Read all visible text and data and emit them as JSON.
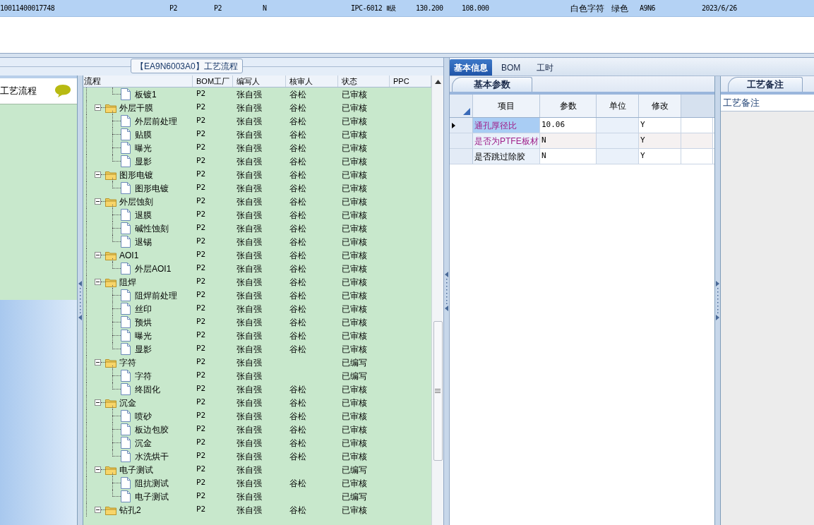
{
  "top_row": {
    "cells": [
      "10011400017748",
      "P2",
      "P2",
      "N",
      "IPC-6012 Ⅱ级",
      "130.200",
      "108.000",
      "白色字符",
      "绿色",
      "A9N6",
      "2023/6/26"
    ]
  },
  "group_title": "【EA9N6003A0】工艺流程",
  "left_panel": {
    "title": "工艺流程"
  },
  "tree": {
    "columns": [
      "流程",
      "BOM工厂",
      "编写人",
      "核审人",
      "状态",
      "PPC"
    ],
    "continued": [
      {
        "name": "板镀1",
        "bom": "P2",
        "writer": "张自强",
        "reviewer": "谷松",
        "status": "已审核"
      }
    ],
    "rows": [
      {
        "name": "外层干膜",
        "bom": "P2",
        "writer": "张自强",
        "reviewer": "谷松",
        "status": "已审核",
        "expanded": true,
        "children": [
          {
            "name": "外层前处理",
            "bom": "P2",
            "writer": "张自强",
            "reviewer": "谷松",
            "status": "已审核"
          },
          {
            "name": "贴膜",
            "bom": "P2",
            "writer": "张自强",
            "reviewer": "谷松",
            "status": "已审核"
          },
          {
            "name": "曝光",
            "bom": "P2",
            "writer": "张自强",
            "reviewer": "谷松",
            "status": "已审核"
          },
          {
            "name": "显影",
            "bom": "P2",
            "writer": "张自强",
            "reviewer": "谷松",
            "status": "已审核"
          }
        ]
      },
      {
        "name": "图形电镀",
        "bom": "P2",
        "writer": "张自强",
        "reviewer": "谷松",
        "status": "已审核",
        "expanded": true,
        "children": [
          {
            "name": "图形电镀",
            "bom": "P2",
            "writer": "张自强",
            "reviewer": "谷松",
            "status": "已审核"
          }
        ]
      },
      {
        "name": "外层蚀刻",
        "bom": "P2",
        "writer": "张自强",
        "reviewer": "谷松",
        "status": "已审核",
        "expanded": true,
        "children": [
          {
            "name": "退膜",
            "bom": "P2",
            "writer": "张自强",
            "reviewer": "谷松",
            "status": "已审核"
          },
          {
            "name": "碱性蚀刻",
            "bom": "P2",
            "writer": "张自强",
            "reviewer": "谷松",
            "status": "已审核"
          },
          {
            "name": "退锡",
            "bom": "P2",
            "writer": "张自强",
            "reviewer": "谷松",
            "status": "已审核"
          }
        ]
      },
      {
        "name": "AOI1",
        "bom": "P2",
        "writer": "张自强",
        "reviewer": "谷松",
        "status": "已审核",
        "expanded": true,
        "children": [
          {
            "name": "外层AOI1",
            "bom": "P2",
            "writer": "张自强",
            "reviewer": "谷松",
            "status": "已审核"
          }
        ]
      },
      {
        "name": "阻焊",
        "bom": "P2",
        "writer": "张自强",
        "reviewer": "谷松",
        "status": "已审核",
        "expanded": true,
        "children": [
          {
            "name": "阻焊前处理",
            "bom": "P2",
            "writer": "张自强",
            "reviewer": "谷松",
            "status": "已审核"
          },
          {
            "name": "丝印",
            "bom": "P2",
            "writer": "张自强",
            "reviewer": "谷松",
            "status": "已审核"
          },
          {
            "name": "预烘",
            "bom": "P2",
            "writer": "张自强",
            "reviewer": "谷松",
            "status": "已审核"
          },
          {
            "name": "曝光",
            "bom": "P2",
            "writer": "张自强",
            "reviewer": "谷松",
            "status": "已审核"
          },
          {
            "name": "显影",
            "bom": "P2",
            "writer": "张自强",
            "reviewer": "谷松",
            "status": "已审核"
          }
        ]
      },
      {
        "name": "字符",
        "bom": "P2",
        "writer": "张自强",
        "status": "已编写",
        "expanded": true,
        "children": [
          {
            "name": "字符",
            "bom": "P2",
            "writer": "张自强",
            "status": "已编写"
          },
          {
            "name": "终固化",
            "bom": "P2",
            "writer": "张自强",
            "reviewer": "谷松",
            "status": "已审核"
          }
        ]
      },
      {
        "name": "沉金",
        "bom": "P2",
        "writer": "张自强",
        "reviewer": "谷松",
        "status": "已审核",
        "expanded": true,
        "children": [
          {
            "name": "喷砂",
            "bom": "P2",
            "writer": "张自强",
            "reviewer": "谷松",
            "status": "已审核"
          },
          {
            "name": "板边包胶",
            "bom": "P2",
            "writer": "张自强",
            "reviewer": "谷松",
            "status": "已审核"
          },
          {
            "name": "沉金",
            "bom": "P2",
            "writer": "张自强",
            "reviewer": "谷松",
            "status": "已审核"
          },
          {
            "name": "水洗烘干",
            "bom": "P2",
            "writer": "张自强",
            "reviewer": "谷松",
            "status": "已审核"
          }
        ]
      },
      {
        "name": "电子测试",
        "bom": "P2",
        "writer": "张自强",
        "status": "已编写",
        "expanded": true,
        "children": [
          {
            "name": "阻抗测试",
            "bom": "P2",
            "writer": "张自强",
            "reviewer": "谷松",
            "status": "已审核"
          },
          {
            "name": "电子测试",
            "bom": "P2",
            "writer": "张自强",
            "status": "已编写"
          }
        ]
      },
      {
        "name": "钻孔2",
        "bom": "P2",
        "writer": "张自强",
        "reviewer": "谷松",
        "status": "已审核",
        "expanded": true
      }
    ]
  },
  "right_tabs": [
    {
      "label": "基本信息",
      "selected": true
    },
    {
      "label": "BOM",
      "selected": false
    },
    {
      "label": "工时",
      "selected": false
    }
  ],
  "params": {
    "tab": "基本参数",
    "columns": [
      "项目",
      "参数",
      "单位",
      "修改"
    ],
    "rows": [
      {
        "item": "通孔厚径比",
        "value": "10.06",
        "modify": "Y",
        "highlighted": true,
        "selected": true
      },
      {
        "item": "是否为PTFE板材",
        "value": "N",
        "modify": "Y",
        "highlighted": true,
        "selected": false
      },
      {
        "item": "是否跳过除胶",
        "value": "N",
        "modify": "Y",
        "highlighted": false,
        "selected": false
      }
    ]
  },
  "notes": {
    "tab": "工艺备注",
    "label": "工艺备注"
  }
}
